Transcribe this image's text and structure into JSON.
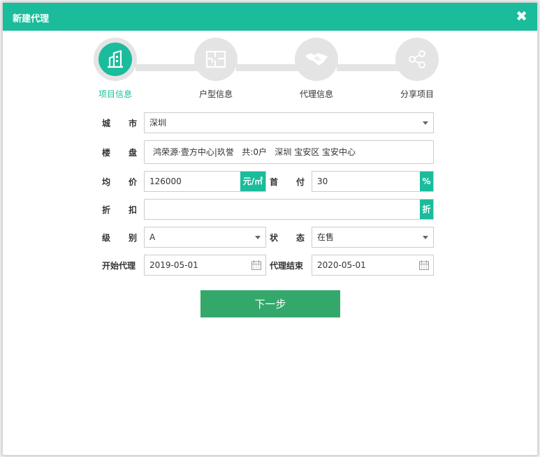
{
  "dialog": {
    "title": "新建代理",
    "close_symbol": "✖"
  },
  "steps": [
    {
      "label": "项目信息",
      "icon": "building-icon",
      "active": true
    },
    {
      "label": "户型信息",
      "icon": "floorplan-icon",
      "active": false
    },
    {
      "label": "代理信息",
      "icon": "handshake-icon",
      "active": false
    },
    {
      "label": "分享项目",
      "icon": "share-icon",
      "active": false
    }
  ],
  "form": {
    "city": {
      "label_a": "城",
      "label_b": "市",
      "value": "深圳"
    },
    "estate": {
      "label_a": "楼",
      "label_b": "盘",
      "value": "鸿荣源·壹方中心|玖誉   共:0户   深圳 宝安区 宝安中心"
    },
    "avg_price": {
      "label_a": "均",
      "label_b": "价",
      "value": "126000",
      "unit": "元/㎡"
    },
    "down_payment": {
      "label_a": "首",
      "label_b": "付",
      "value": "30",
      "unit": "%"
    },
    "discount": {
      "label_a": "折",
      "label_b": "扣",
      "value": "",
      "unit": "折"
    },
    "grade": {
      "label_a": "级",
      "label_b": "别",
      "value": "A"
    },
    "status": {
      "label_a": "状",
      "label_b": "态",
      "value": "在售"
    },
    "start_date": {
      "label": "开始代理",
      "value": "2019-05-01"
    },
    "end_date": {
      "label": "代理结束",
      "value": "2020-05-01"
    }
  },
  "next_button": {
    "label": "下一步"
  },
  "colors": {
    "accent": "#1abc9c",
    "button": "#33a86a",
    "inactive": "#e4e4e4"
  }
}
